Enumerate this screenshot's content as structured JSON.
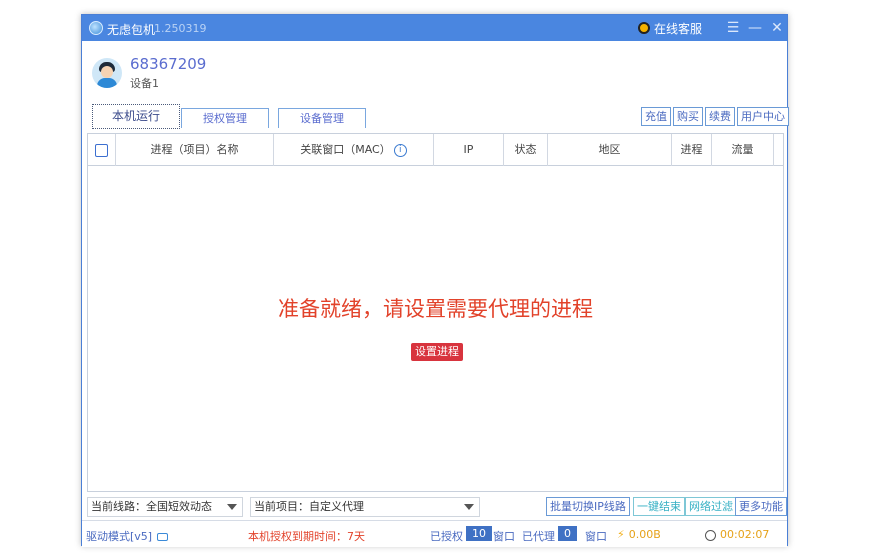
{
  "titlebar": {
    "app_name": "无虑包机",
    "version": "1.250319",
    "support_label": "在线客服",
    "menu_glyph": "☰",
    "minimize_glyph": "—",
    "close_glyph": "✕"
  },
  "user": {
    "id": "68367209",
    "device": "设备1"
  },
  "tabs": [
    {
      "label": "本机运行",
      "active": true
    },
    {
      "label": "授权管理",
      "active": false
    },
    {
      "label": "设备管理",
      "active": false
    }
  ],
  "right_buttons": [
    "充值",
    "购买",
    "续费",
    "用户中心"
  ],
  "table": {
    "columns": [
      "进程（项目）名称",
      "关联窗口（MAC）",
      "IP",
      "状态",
      "地区",
      "进程",
      "流量"
    ],
    "info_glyph": "i",
    "rows": []
  },
  "empty_state": {
    "message": "准备就绪，请设置需要代理的进程",
    "button_label": "设置进程"
  },
  "bottom": {
    "route_label": "当前线路：全国短效动态",
    "project_label": "当前项目：自定义代理",
    "batch_switch_label": "批量切换IP线路",
    "end_all_label": "一键结束",
    "net_filter_label": "网络过滤",
    "more_label": "更多功能"
  },
  "status": {
    "driver_mode": "驱动模式[v5]",
    "expiry": "本机授权到期时间：7天",
    "authorized_label": "已授权",
    "authorized_count": "10",
    "window_label_1": "窗口",
    "proxied_label": "已代理",
    "proxied_count": "0",
    "window_label_2": "窗口",
    "traffic": "0.00B",
    "timer": "00:02:07"
  },
  "colors": {
    "titlebar": "#4a86e0",
    "accent": "#4a6ac0",
    "message_red": "#e2422a",
    "button_red": "#d8343e",
    "count_blue": "#3f71c4",
    "traffic_orange": "#e6a21a"
  }
}
